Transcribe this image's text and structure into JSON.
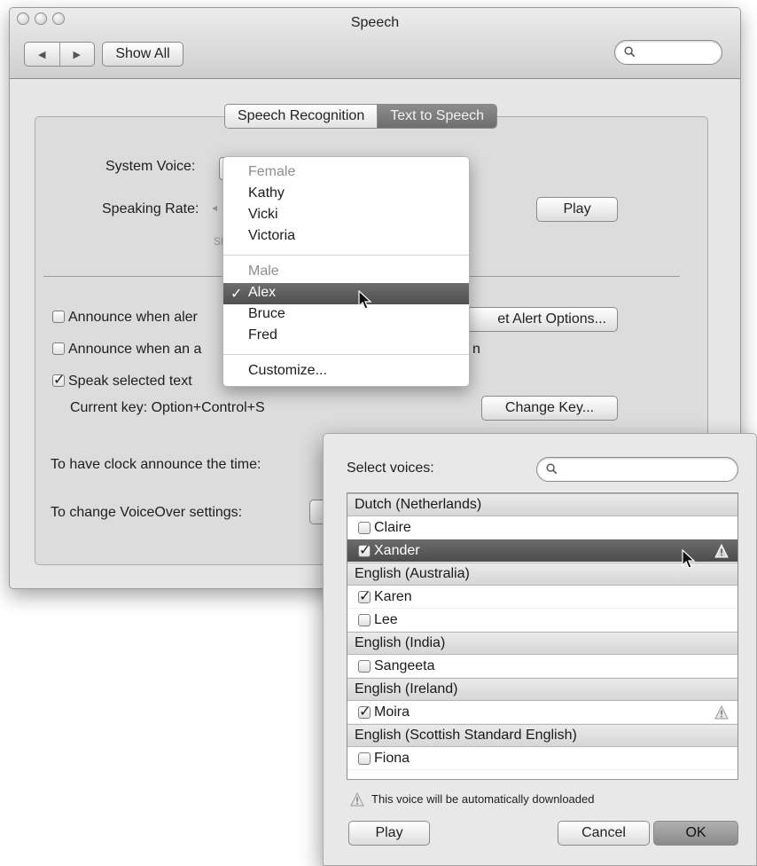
{
  "window": {
    "title": "Speech",
    "show_all": "Show All"
  },
  "tabs": {
    "recognition": "Speech Recognition",
    "tts": "Text to Speech"
  },
  "settings": {
    "system_voice_label": "System Voice:",
    "speaking_rate_label": "Speaking Rate:",
    "play": "Play",
    "announce_alerts": "Announce when aler",
    "announce_app": "Announce when an a",
    "set_alert_options": "et Alert Options...",
    "announce_app_tail": "n",
    "speak_selected": "Speak selected text ",
    "current_key": "Current key: Option+Control+S",
    "change_key": "Change Key...",
    "clock_label": "To have clock announce the time:",
    "voiceover_label": "To change VoiceOver settings:"
  },
  "voice_menu": {
    "female_header": "Female",
    "female": [
      "Kathy",
      "Vicki",
      "Victoria"
    ],
    "male_header": "Male",
    "male_selected": "Alex",
    "male": [
      "Bruce",
      "Fred"
    ],
    "customize": "Customize..."
  },
  "select_voices": {
    "label": "Select voices:",
    "groups": [
      {
        "name": "Dutch (Netherlands)",
        "voices": [
          {
            "name": "Claire",
            "checked": false
          },
          {
            "name": "Xander",
            "checked": true,
            "selected": true,
            "download": true
          }
        ]
      },
      {
        "name": "English (Australia)",
        "voices": [
          {
            "name": "Karen",
            "checked": true
          },
          {
            "name": "Lee",
            "checked": false
          }
        ]
      },
      {
        "name": "English (India)",
        "voices": [
          {
            "name": "Sangeeta",
            "checked": false
          }
        ]
      },
      {
        "name": "English (Ireland)",
        "voices": [
          {
            "name": "Moira",
            "checked": true,
            "download": true
          }
        ]
      },
      {
        "name": "English (Scottish Standard English)",
        "voices": [
          {
            "name": "Fiona",
            "checked": false
          }
        ]
      }
    ],
    "note": "This voice will be automatically downloaded",
    "play": "Play",
    "cancel": "Cancel",
    "ok": "OK"
  }
}
